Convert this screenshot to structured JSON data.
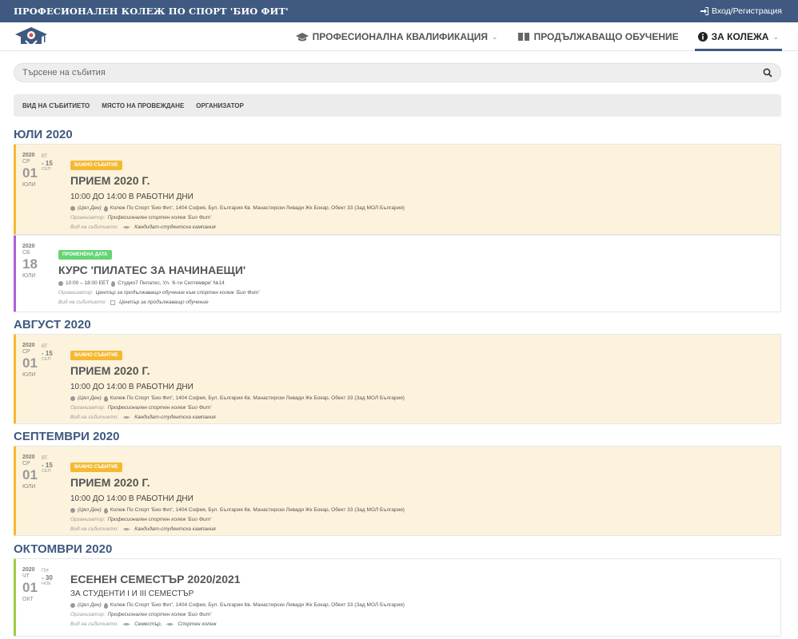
{
  "header": {
    "brand": "ПРОФЕСИОНАЛЕН КОЛЕЖ ПО СПОРТ 'БИО ФИТ'",
    "login": "Вход/Регистрация"
  },
  "nav": {
    "item1": "ПРОФЕСИОНАЛНА КВАЛИФИКАЦИЯ",
    "item2": "ПРОДЪЛЖАВАЩО ОБУЧЕНИЕ",
    "item3": "ЗА КОЛЕЖА"
  },
  "search": {
    "placeholder": "Търсене на събития"
  },
  "filters": [
    "ВИД НА СЪБИТИЕТО",
    "МЯСТО НА ПРОВЕЖДАНЕ",
    "ОРГАНИЗАТОР"
  ],
  "months": [
    "ЮЛИ 2020",
    "АВГУСТ 2020",
    "СЕПТЕМВРИ 2020",
    "ОКТОМВРИ 2020"
  ],
  "labels": {
    "organizer": "Организатор:",
    "type": "Вид на събитието:"
  },
  "events": [
    {
      "year": "2020",
      "weekday": "СР",
      "day": "01",
      "month": "ЮЛИ",
      "end_wd": "ВТ",
      "end_day": "- 15",
      "end_month": "СЕП",
      "badge": "ВАЖНО СЪБИТИЕ",
      "title": "ПРИЕМ 2020 Г.",
      "subtitle": "10:00 ДО 14:00 В РАБОТНИ ДНИ",
      "time": "(Цял Ден)",
      "location": "Колеж По Спорт 'Био Фит', 1404 София, Бул. България Кв. Манастирски Ливади Жк Бокар, Обект 33 (Зад МОЛ България)",
      "organizer": "Професионален спортен колеж 'Био Фит'",
      "type": "Кандидат-студентска кампания"
    },
    {
      "year": "2020",
      "weekday": "СБ",
      "day": "18",
      "month": "ЮЛИ",
      "badge": "ПРОМЕНЕНА ДАТА",
      "title": "КУРС 'ПИЛАТЕС ЗА НАЧИНАЕЩИ'",
      "time": "10:00 – 18:00 EET",
      "location": "Студио7 Пилатес, Ул. '6-ти Септември' №14",
      "organizer": "Център за продължаващо обучение към спортен колеж 'Био Фит'",
      "type": "Център за продължаващо обучение"
    },
    {
      "year": "2020",
      "weekday": "СР",
      "day": "01",
      "month": "ЮЛИ",
      "end_wd": "ВТ",
      "end_day": "- 15",
      "end_month": "СЕП",
      "badge": "ВАЖНО СЪБИТИЕ",
      "title": "ПРИЕМ 2020 Г.",
      "subtitle": "10:00 ДО 14:00 В РАБОТНИ ДНИ",
      "time": "(Цял Ден)",
      "location": "Колеж По Спорт 'Био Фит', 1404 София, Бул. България Кв. Манастирски Ливади Жк Бокар, Обект 33 (Зад МОЛ България)",
      "organizer": "Професионален спортен колеж 'Био Фит'",
      "type": "Кандидат-студентска кампания"
    },
    {
      "year": "2020",
      "weekday": "СР",
      "day": "01",
      "month": "ЮЛИ",
      "end_wd": "ВТ",
      "end_day": "- 15",
      "end_month": "СЕП",
      "badge": "ВАЖНО СЪБИТИЕ",
      "title": "ПРИЕМ 2020 Г.",
      "subtitle": "10:00 ДО 14:00 В РАБОТНИ ДНИ",
      "time": "(Цял Ден)",
      "location": "Колеж По Спорт 'Био Фит', 1404 София, Бул. България Кв. Манастирски Ливади Жк Бокар, Обект 33 (Зад МОЛ България)",
      "organizer": "Професионален спортен колеж 'Био Фит'",
      "type": "Кандидат-студентска кампания"
    },
    {
      "year": "2020",
      "weekday": "ЧТ",
      "day": "01",
      "month": "ОКТ",
      "end_wd": "ПН",
      "end_day": "- 30",
      "end_month": "НОЕ",
      "title": "ЕСЕНЕН СЕМЕСТЪР 2020/2021",
      "subtitle": "ЗА СТУДЕНТИ I И III СЕМЕСТЪР",
      "time": "(Цял Ден)",
      "location": "Колеж По Спорт 'Био Фит', 1404 София, Бул. България Кв. Манастирски Ливади Жк Бокар, Обект 33 (Зад МОЛ България)",
      "organizer": "Професионален спортен колеж 'Био Фит'",
      "type": "Семестър,",
      "type2": "Спортен колеж"
    }
  ]
}
